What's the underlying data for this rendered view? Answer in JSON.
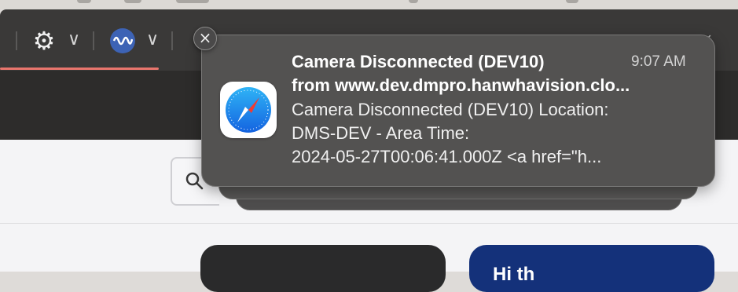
{
  "browser": {
    "extensions": [
      {
        "icon": "gear-icon",
        "chevron": "∨"
      },
      {
        "icon": "wave-icon",
        "chevron": "∨"
      }
    ]
  },
  "notification": {
    "close_glyph": "×",
    "app_icon": "safari-compass-icon",
    "title": "Camera Disconnected (DEV10)",
    "time": "9:07 AM",
    "subtitle": "from www.dev.dmpro.hanwhavision.clo...",
    "body_lines": [
      "Camera Disconnected (DEV10) Location:",
      "DMS-DEV - Area Time:",
      "2024-05-27T00:06:41.000Z   <a href=\"h..."
    ]
  },
  "page": {
    "search_icon": "search-icon",
    "card_text": "Hi th"
  },
  "colors": {
    "notification_bg": "#535251",
    "loading_bar": "#e9766d",
    "card_blue": "#14317a",
    "card_dark": "#2a2a2b"
  }
}
